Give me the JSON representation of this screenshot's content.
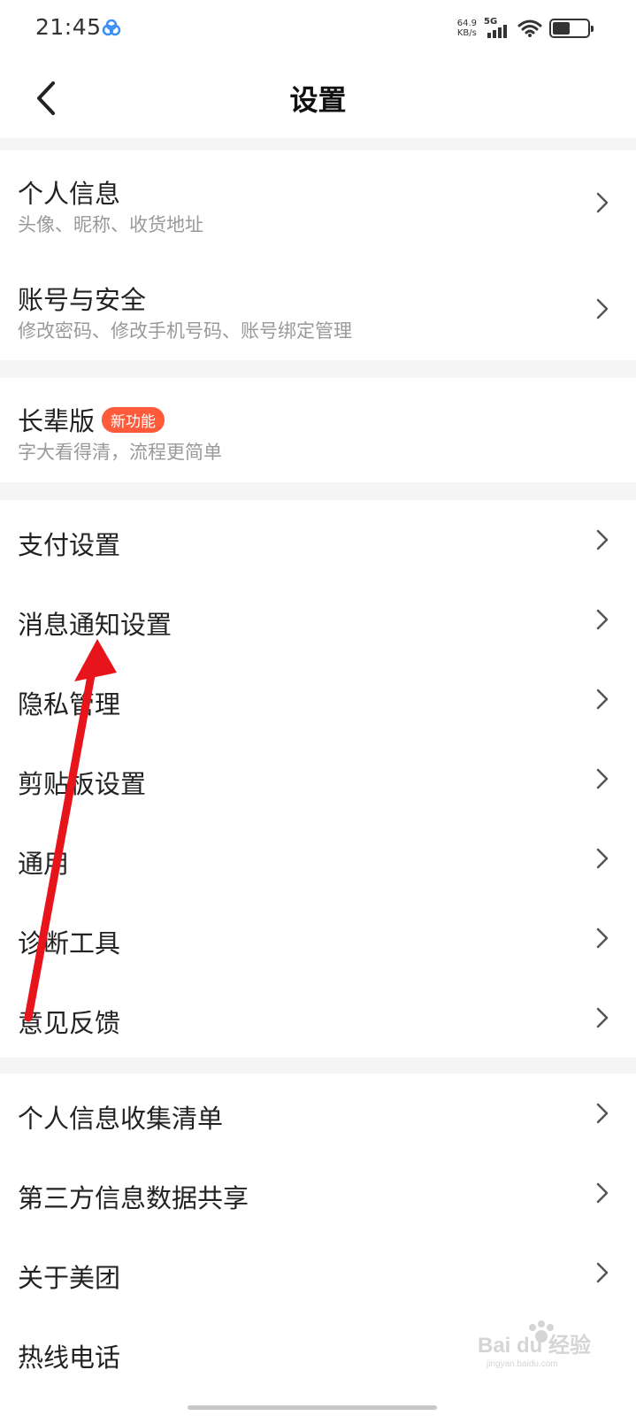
{
  "status_bar": {
    "time": "21:45",
    "net_speed_value": "64.9",
    "net_speed_unit": "KB/s",
    "network_type": "5G",
    "battery_level": 0.55
  },
  "nav": {
    "title": "设置"
  },
  "groups": [
    [
      {
        "title": "个人信息",
        "subtitle": "头像、昵称、收货地址"
      },
      {
        "title": "账号与安全",
        "subtitle": "修改密码、修改手机号码、账号绑定管理"
      }
    ],
    [
      {
        "title": "长辈版",
        "badge": "新功能",
        "subtitle": "字大看得清，流程更简单"
      }
    ],
    [
      {
        "title": "支付设置"
      },
      {
        "title": "消息通知设置"
      },
      {
        "title": "隐私管理"
      },
      {
        "title": "剪贴板设置"
      },
      {
        "title": "通用"
      },
      {
        "title": "诊断工具"
      },
      {
        "title": "意见反馈"
      }
    ],
    [
      {
        "title": "个人信息收集清单"
      },
      {
        "title": "第三方信息数据共享"
      },
      {
        "title": "关于美团"
      },
      {
        "title": "热线电话"
      }
    ]
  ],
  "colors": {
    "badge": "#ff5a3a",
    "annotation_arrow": "#e8141b",
    "section_gap": "#f5f5f5"
  },
  "watermark": {
    "text": "Bai du 经验",
    "subtext": "jingyan.baidu.com"
  }
}
